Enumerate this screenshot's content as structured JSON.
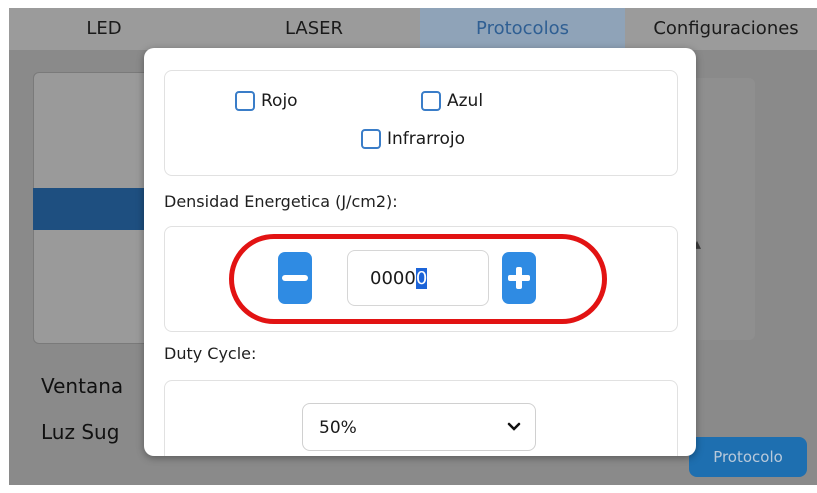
{
  "tabs": [
    "LED",
    "LASER",
    "Protocolos",
    "Configuraciones"
  ],
  "background": {
    "text1": "Ventana",
    "text2": "Luz Sug",
    "button": "Protocolo"
  },
  "modal": {
    "colors": {
      "rojo": "Rojo",
      "azul": "Azul",
      "infrarrojo": "Infrarrojo"
    },
    "density_label": "Densidad Energetica (J/cm2):",
    "density_value_main": "0000",
    "density_value_selected": "0",
    "duty_label": "Duty Cycle:",
    "duty_value": "50%"
  },
  "accent": "#2f8be3",
  "highlight": "#e21313"
}
